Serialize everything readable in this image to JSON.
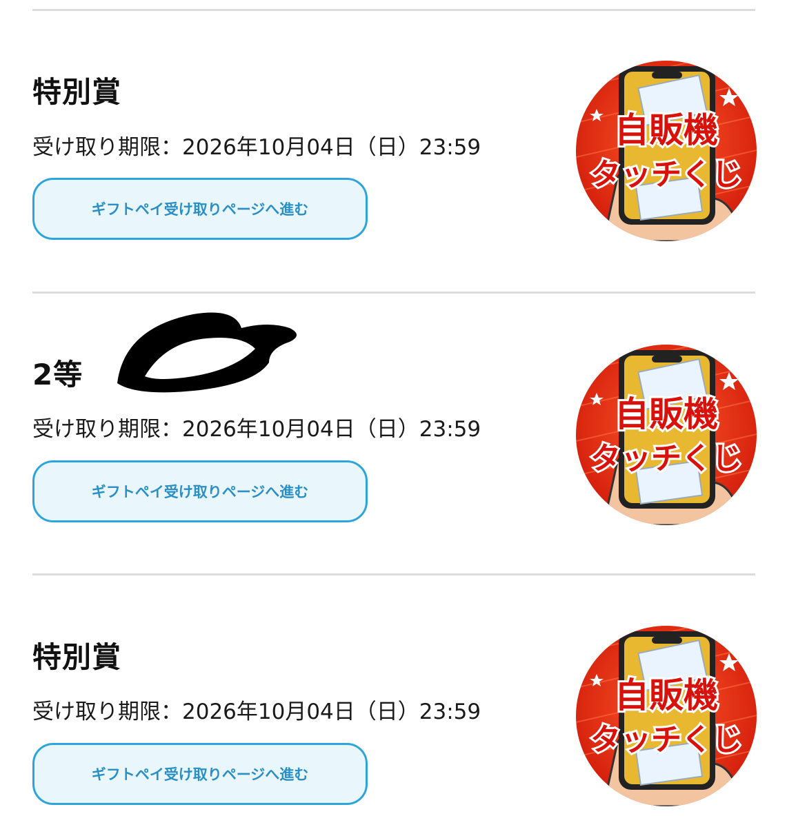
{
  "colors": {
    "button_border": "#2ea4dc",
    "button_bg": "#e9f7fd",
    "button_text": "#2a8fc6",
    "logo_red": "#e42a12",
    "logo_gold": "#e8b830",
    "divider": "#dcdcdc"
  },
  "prizes": [
    {
      "title": "特別賞",
      "deadline": "受け取り期限：2026年10月04日（日）23:59",
      "button_label": "ギフトペイ受け取りページへ進む",
      "logo_line1": "自販機",
      "logo_line2": "タッチくじ"
    },
    {
      "title": "2等",
      "deadline": "受け取り期限：2026年10月04日（日）23:59",
      "button_label": "ギフトペイ受け取りページへ進む",
      "logo_line1": "自販機",
      "logo_line2": "タッチくじ"
    },
    {
      "title": "特別賞",
      "deadline": "受け取り期限：2026年10月04日（日）23:59",
      "button_label": "ギフトペイ受け取りページへ進む",
      "logo_line1": "自販機",
      "logo_line2": "タッチくじ"
    }
  ]
}
